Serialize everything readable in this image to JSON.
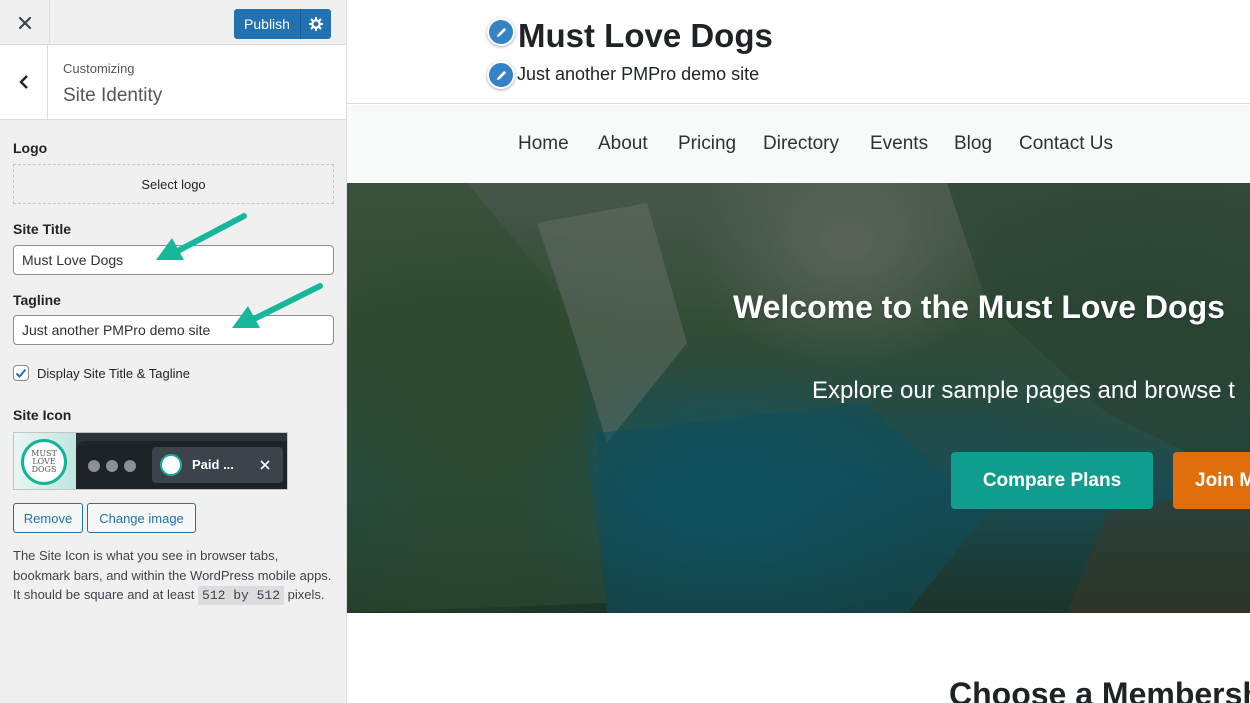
{
  "customizer": {
    "topbar": {
      "publish_label": "Publish"
    },
    "header": {
      "breadcrumb": "Customizing",
      "section_title": "Site Identity"
    },
    "logo": {
      "label": "Logo",
      "select_label": "Select logo"
    },
    "site_title": {
      "label": "Site Title",
      "value": "Must Love Dogs"
    },
    "tagline": {
      "label": "Tagline",
      "value": "Just another PMPro demo site"
    },
    "display_checkbox": {
      "label": "Display Site Title & Tagline",
      "checked": true
    },
    "site_icon": {
      "label": "Site Icon",
      "preview_tab_title": "Paid ...",
      "icon_text": "MUST LOVE DOGS",
      "remove_label": "Remove",
      "change_label": "Change image",
      "description_before": "The Site Icon is what you see in browser tabs, bookmark bars, and within the WordPress mobile apps. It should be square and at least ",
      "description_code": "512 by 512",
      "description_after": " pixels."
    }
  },
  "preview": {
    "site_title": "Must Love Dogs",
    "site_tagline": "Just another PMPro demo site",
    "nav": [
      "Home",
      "About",
      "Pricing",
      "Directory",
      "Events",
      "Blog",
      "Contact Us"
    ],
    "hero": {
      "title": "Welcome to the Must Love Dogs",
      "subtitle": "Explore our sample pages and browse t",
      "btn_compare": "Compare Plans",
      "btn_join": "Join M"
    },
    "section_heading": "Choose a Membership"
  },
  "colors": {
    "wp_blue": "#2271b1",
    "accent_teal": "#0f9e8e",
    "accent_orange": "#e06e0b",
    "annotation_arrow": "#17b89a"
  }
}
